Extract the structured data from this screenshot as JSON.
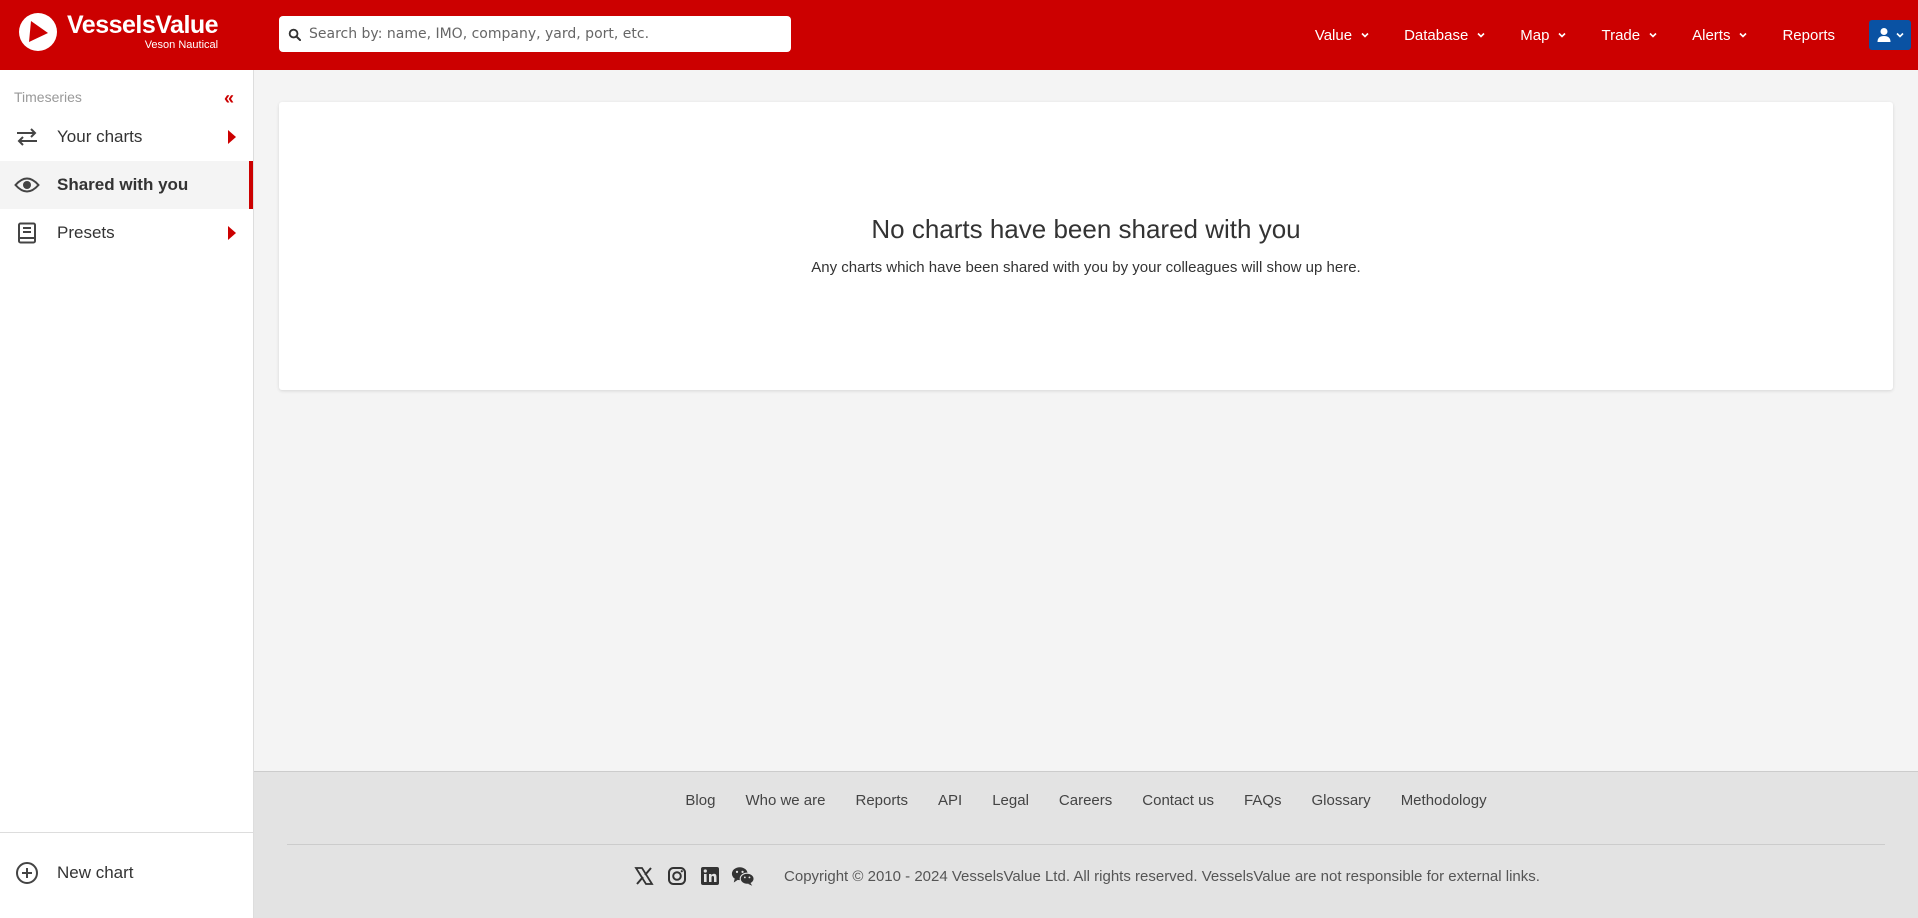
{
  "brand": {
    "name": "VesselsValue",
    "sub": "Veson Nautical",
    "color": "#cc0000"
  },
  "search": {
    "placeholder": "Search by: name, IMO, company, yard, port, etc.",
    "value": ""
  },
  "nav": {
    "items": [
      {
        "label": "Value",
        "has_dropdown": true
      },
      {
        "label": "Database",
        "has_dropdown": true
      },
      {
        "label": "Map",
        "has_dropdown": true
      },
      {
        "label": "Trade",
        "has_dropdown": true
      },
      {
        "label": "Alerts",
        "has_dropdown": true
      },
      {
        "label": "Reports",
        "has_dropdown": false
      }
    ],
    "user_icon": "user-icon",
    "user_button_color": "#0a52a3"
  },
  "sidebar": {
    "heading": "Timeseries",
    "collapse_icon": "«",
    "items": [
      {
        "label": "Your charts",
        "icon": "swap-arrows-icon",
        "active": false,
        "expandable": true
      },
      {
        "label": "Shared with you",
        "icon": "eye-icon",
        "active": true,
        "expandable": false
      },
      {
        "label": "Presets",
        "icon": "book-icon",
        "active": false,
        "expandable": true
      }
    ],
    "new_chart": {
      "label": "New chart",
      "icon": "plus-circle-icon"
    }
  },
  "main": {
    "empty_title": "No charts have been shared with you",
    "empty_text": "Any charts which have been shared with you by your colleagues will show up here."
  },
  "footer": {
    "links": [
      "Blog",
      "Who we are",
      "Reports",
      "API",
      "Legal",
      "Careers",
      "Contact us",
      "FAQs",
      "Glossary",
      "Methodology"
    ],
    "social": [
      "x-icon",
      "instagram-icon",
      "linkedin-icon",
      "wechat-icon"
    ],
    "copyright": "Copyright © 2010 - 2024 VesselsValue Ltd. All rights reserved. VesselsValue are not responsible for external links."
  }
}
